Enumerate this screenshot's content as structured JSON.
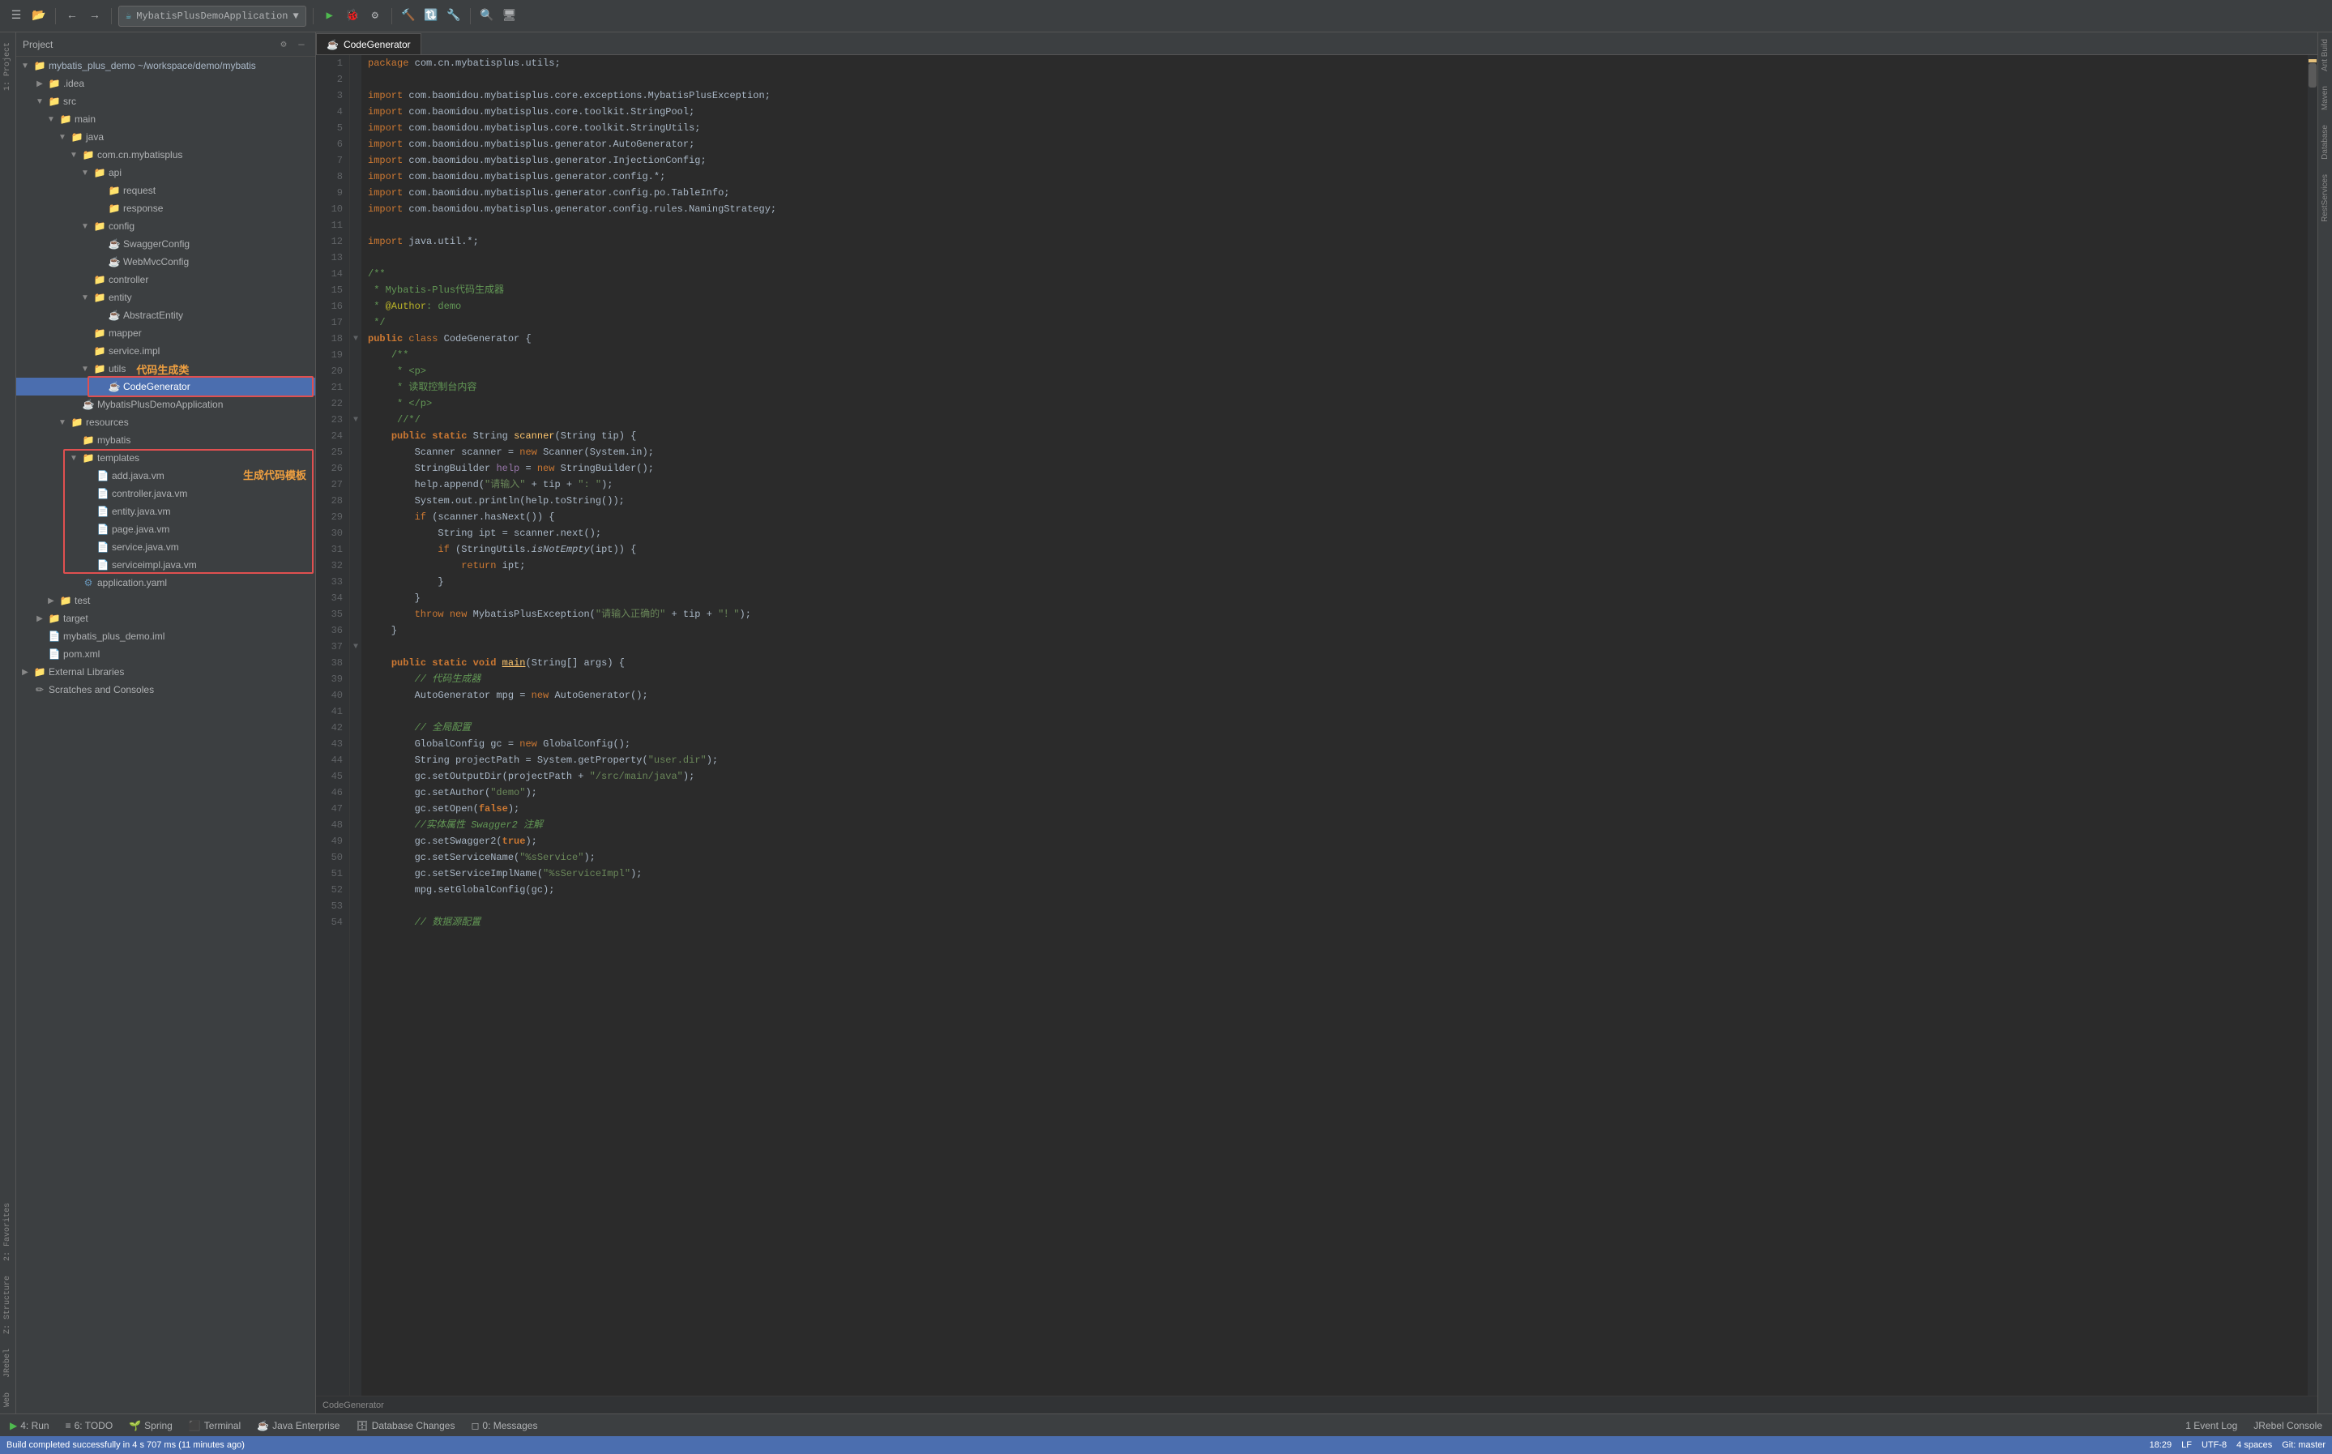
{
  "toolbar": {
    "project_name": "MybatisPlusDemoApplication",
    "run_icon": "▶",
    "debug_icon": "🐞",
    "buttons": [
      "≡",
      "📁",
      "↩",
      "↪",
      "⚡",
      "▶",
      "⏸",
      "⏹",
      "⚙",
      "🔨",
      "🔧",
      "📦",
      "🔍",
      "🖥",
      "🔲",
      "🔎"
    ]
  },
  "sidebar": {
    "title": "Project",
    "items": [
      {
        "indent": 0,
        "icon": "folder",
        "label": "mybatis_plus_demo ~/workspace/demo/mybatis",
        "arrow": "▼",
        "hasArrow": true
      },
      {
        "indent": 1,
        "icon": "folder",
        "label": ".idea",
        "arrow": "▶",
        "hasArrow": true
      },
      {
        "indent": 1,
        "icon": "folder",
        "label": "src",
        "arrow": "▼",
        "hasArrow": true
      },
      {
        "indent": 2,
        "icon": "folder",
        "label": "main",
        "arrow": "▼",
        "hasArrow": true
      },
      {
        "indent": 3,
        "icon": "folder",
        "label": "java",
        "arrow": "▼",
        "hasArrow": true
      },
      {
        "indent": 4,
        "icon": "folder",
        "label": "com.cn.mybatisplus",
        "arrow": "▼",
        "hasArrow": true
      },
      {
        "indent": 5,
        "icon": "folder",
        "label": "api",
        "arrow": "▼",
        "hasArrow": true
      },
      {
        "indent": 6,
        "icon": "folder",
        "label": "request",
        "arrow": "",
        "hasArrow": false
      },
      {
        "indent": 6,
        "icon": "folder",
        "label": "response",
        "arrow": "",
        "hasArrow": false
      },
      {
        "indent": 5,
        "icon": "folder",
        "label": "config",
        "arrow": "▼",
        "hasArrow": true
      },
      {
        "indent": 6,
        "icon": "java",
        "label": "SwaggerConfig",
        "arrow": "",
        "hasArrow": false
      },
      {
        "indent": 6,
        "icon": "java",
        "label": "WebMvcConfig",
        "arrow": "",
        "hasArrow": false
      },
      {
        "indent": 5,
        "icon": "folder",
        "label": "controller",
        "arrow": "",
        "hasArrow": false
      },
      {
        "indent": 5,
        "icon": "folder",
        "label": "entity",
        "arrow": "▼",
        "hasArrow": true
      },
      {
        "indent": 6,
        "icon": "java",
        "label": "AbstractEntity",
        "arrow": "",
        "hasArrow": false
      },
      {
        "indent": 5,
        "icon": "folder",
        "label": "mapper",
        "arrow": "",
        "hasArrow": false
      },
      {
        "indent": 5,
        "icon": "folder",
        "label": "service.impl",
        "arrow": "",
        "hasArrow": false
      },
      {
        "indent": 5,
        "icon": "folder",
        "label": "utils",
        "arrow": "▼",
        "hasArrow": true
      },
      {
        "indent": 6,
        "icon": "java",
        "label": "CodeGenerator",
        "arrow": "",
        "hasArrow": false,
        "selected": true
      },
      {
        "indent": 4,
        "icon": "java",
        "label": "MybatisPlusDemoApplication",
        "arrow": "",
        "hasArrow": false
      },
      {
        "indent": 3,
        "icon": "folder",
        "label": "resources",
        "arrow": "▼",
        "hasArrow": true
      },
      {
        "indent": 4,
        "icon": "folder",
        "label": "mybatis",
        "arrow": "",
        "hasArrow": false
      },
      {
        "indent": 4,
        "icon": "folder",
        "label": "templates",
        "arrow": "▼",
        "hasArrow": true
      },
      {
        "indent": 5,
        "icon": "vm",
        "label": "add.java.vm",
        "arrow": "",
        "hasArrow": false
      },
      {
        "indent": 5,
        "icon": "vm",
        "label": "controller.java.vm",
        "arrow": "",
        "hasArrow": false
      },
      {
        "indent": 5,
        "icon": "vm",
        "label": "entity.java.vm",
        "arrow": "",
        "hasArrow": false
      },
      {
        "indent": 5,
        "icon": "vm",
        "label": "page.java.vm",
        "arrow": "",
        "hasArrow": false
      },
      {
        "indent": 5,
        "icon": "vm",
        "label": "service.java.vm",
        "arrow": "",
        "hasArrow": false
      },
      {
        "indent": 5,
        "icon": "vm",
        "label": "serviceimpl.java.vm",
        "arrow": "",
        "hasArrow": false
      },
      {
        "indent": 4,
        "icon": "config",
        "label": "application.yaml",
        "arrow": "",
        "hasArrow": false
      },
      {
        "indent": 2,
        "icon": "folder",
        "label": "test",
        "arrow": "▶",
        "hasArrow": true
      },
      {
        "indent": 1,
        "icon": "folder",
        "label": "target",
        "arrow": "▶",
        "hasArrow": true
      },
      {
        "indent": 1,
        "icon": "iml",
        "label": "mybatis_plus_demo.iml",
        "arrow": "",
        "hasArrow": false
      },
      {
        "indent": 1,
        "icon": "xml",
        "label": "pom.xml",
        "arrow": "",
        "hasArrow": false
      },
      {
        "indent": 0,
        "icon": "folder",
        "label": "External Libraries",
        "arrow": "▶",
        "hasArrow": true
      },
      {
        "indent": 0,
        "icon": "scratch",
        "label": "Scratches and Consoles",
        "arrow": "",
        "hasArrow": false
      }
    ]
  },
  "annotations": {
    "code_class": "代码生成类",
    "template": "生成代码模板"
  },
  "tab": {
    "label": "CodeGenerator"
  },
  "code": {
    "filename": "CodeGenerator",
    "lines": [
      {
        "n": 1,
        "text": "package com.cn.mybatisplus.utils;"
      },
      {
        "n": 2,
        "text": ""
      },
      {
        "n": 3,
        "text": "import com.baomidou.mybatisplus.core.exceptions.MybatisPlusException;"
      },
      {
        "n": 4,
        "text": "import com.baomidou.mybatisplus.core.toolkit.StringPool;"
      },
      {
        "n": 5,
        "text": "import com.baomidou.mybatisplus.core.toolkit.StringUtils;"
      },
      {
        "n": 6,
        "text": "import com.baomidou.mybatisplus.generator.AutoGenerator;"
      },
      {
        "n": 7,
        "text": "import com.baomidou.mybatisplus.generator.InjectionConfig;"
      },
      {
        "n": 8,
        "text": "import com.baomidou.mybatisplus.generator.config.*;"
      },
      {
        "n": 9,
        "text": "import com.baomidou.mybatisplus.generator.config.po.TableInfo;"
      },
      {
        "n": 10,
        "text": "import com.baomidou.mybatisplus.generator.config.rules.NamingStrategy;"
      },
      {
        "n": 11,
        "text": ""
      },
      {
        "n": 12,
        "text": "import java.util.*;"
      },
      {
        "n": 13,
        "text": ""
      },
      {
        "n": 14,
        "text": "/**"
      },
      {
        "n": 15,
        "text": " * Mybatis-Plus代码生成器"
      },
      {
        "n": 16,
        "text": " * @Author: demo"
      },
      {
        "n": 17,
        "text": " */"
      },
      {
        "n": 18,
        "text": "public class CodeGenerator {"
      },
      {
        "n": 19,
        "text": "    /**"
      },
      {
        "n": 20,
        "text": "     * <p>"
      },
      {
        "n": 21,
        "text": "     * 读取控制台内容"
      },
      {
        "n": 22,
        "text": "     * </p>"
      },
      {
        "n": 23,
        "text": "     //*/"
      },
      {
        "n": 24,
        "text": "    public static String scanner(String tip) {"
      },
      {
        "n": 25,
        "text": "        Scanner scanner = new Scanner(System.in);"
      },
      {
        "n": 26,
        "text": "        StringBuilder help = new StringBuilder();"
      },
      {
        "n": 27,
        "text": "        help.append(\"请输入\" + tip + \": \");"
      },
      {
        "n": 28,
        "text": "        System.out.println(help.toString());"
      },
      {
        "n": 29,
        "text": "        if (scanner.hasNext()) {"
      },
      {
        "n": 30,
        "text": "            String ipt = scanner.next();"
      },
      {
        "n": 31,
        "text": "            if (StringUtils.isNotEmpty(ipt)) {"
      },
      {
        "n": 32,
        "text": "                return ipt;"
      },
      {
        "n": 33,
        "text": "            }"
      },
      {
        "n": 34,
        "text": "        }"
      },
      {
        "n": 35,
        "text": "        throw new MybatisPlusException(\"请输入正确的\" + tip + \"！\");"
      },
      {
        "n": 36,
        "text": "    }"
      },
      {
        "n": 37,
        "text": ""
      },
      {
        "n": 38,
        "text": "    public static void main(String[] args) {"
      },
      {
        "n": 39,
        "text": "        // 代码生成器"
      },
      {
        "n": 40,
        "text": "        AutoGenerator mpg = new AutoGenerator();"
      },
      {
        "n": 41,
        "text": ""
      },
      {
        "n": 42,
        "text": "        // 全局配置"
      },
      {
        "n": 43,
        "text": "        GlobalConfig gc = new GlobalConfig();"
      },
      {
        "n": 44,
        "text": "        String projectPath = System.getProperty(\"user.dir\");"
      },
      {
        "n": 45,
        "text": "        gc.setOutputDir(projectPath + \"/src/main/java\");"
      },
      {
        "n": 46,
        "text": "        gc.setAuthor(\"demo\");"
      },
      {
        "n": 47,
        "text": "        gc.setOpen(false);"
      },
      {
        "n": 48,
        "text": "        //实体属性 Swagger2 注解"
      },
      {
        "n": 49,
        "text": "        gc.setSwagger2(true);"
      },
      {
        "n": 50,
        "text": "        gc.setServiceName(\"%sService\");"
      },
      {
        "n": 51,
        "text": "        gc.setServiceImplName(\"%sServiceImpl\");"
      },
      {
        "n": 52,
        "text": "        mpg.setGlobalConfig(gc);"
      },
      {
        "n": 53,
        "text": ""
      },
      {
        "n": 54,
        "text": "        // 数据源配置"
      }
    ]
  },
  "bottom_bar": {
    "items": [
      {
        "icon": "▶",
        "label": "4: Run"
      },
      {
        "icon": "≡",
        "label": "6: TODO"
      },
      {
        "icon": "🌱",
        "label": "Spring"
      },
      {
        "icon": "⬛",
        "label": "Terminal"
      },
      {
        "icon": "☕",
        "label": "Java Enterprise"
      },
      {
        "icon": "🗄",
        "label": "Database Changes"
      },
      {
        "icon": "◻",
        "label": "0: Messages"
      }
    ],
    "right_items": [
      {
        "label": "1 Event Log"
      },
      {
        "label": "JRebel Console"
      }
    ]
  },
  "status_bar": {
    "left": "Build completed successfully in 4 s 707 ms (11 minutes ago)",
    "right_items": [
      "18:29",
      "LF",
      "UTF-8",
      "4 spaces",
      "Git: master"
    ]
  },
  "right_panel_items": [
    "Ant Build",
    "Maven",
    "Database",
    "RestServices"
  ],
  "left_panel_items": [
    "1: Project",
    "2: Favorites",
    "Z: Structure",
    "JRebel",
    "Web"
  ]
}
